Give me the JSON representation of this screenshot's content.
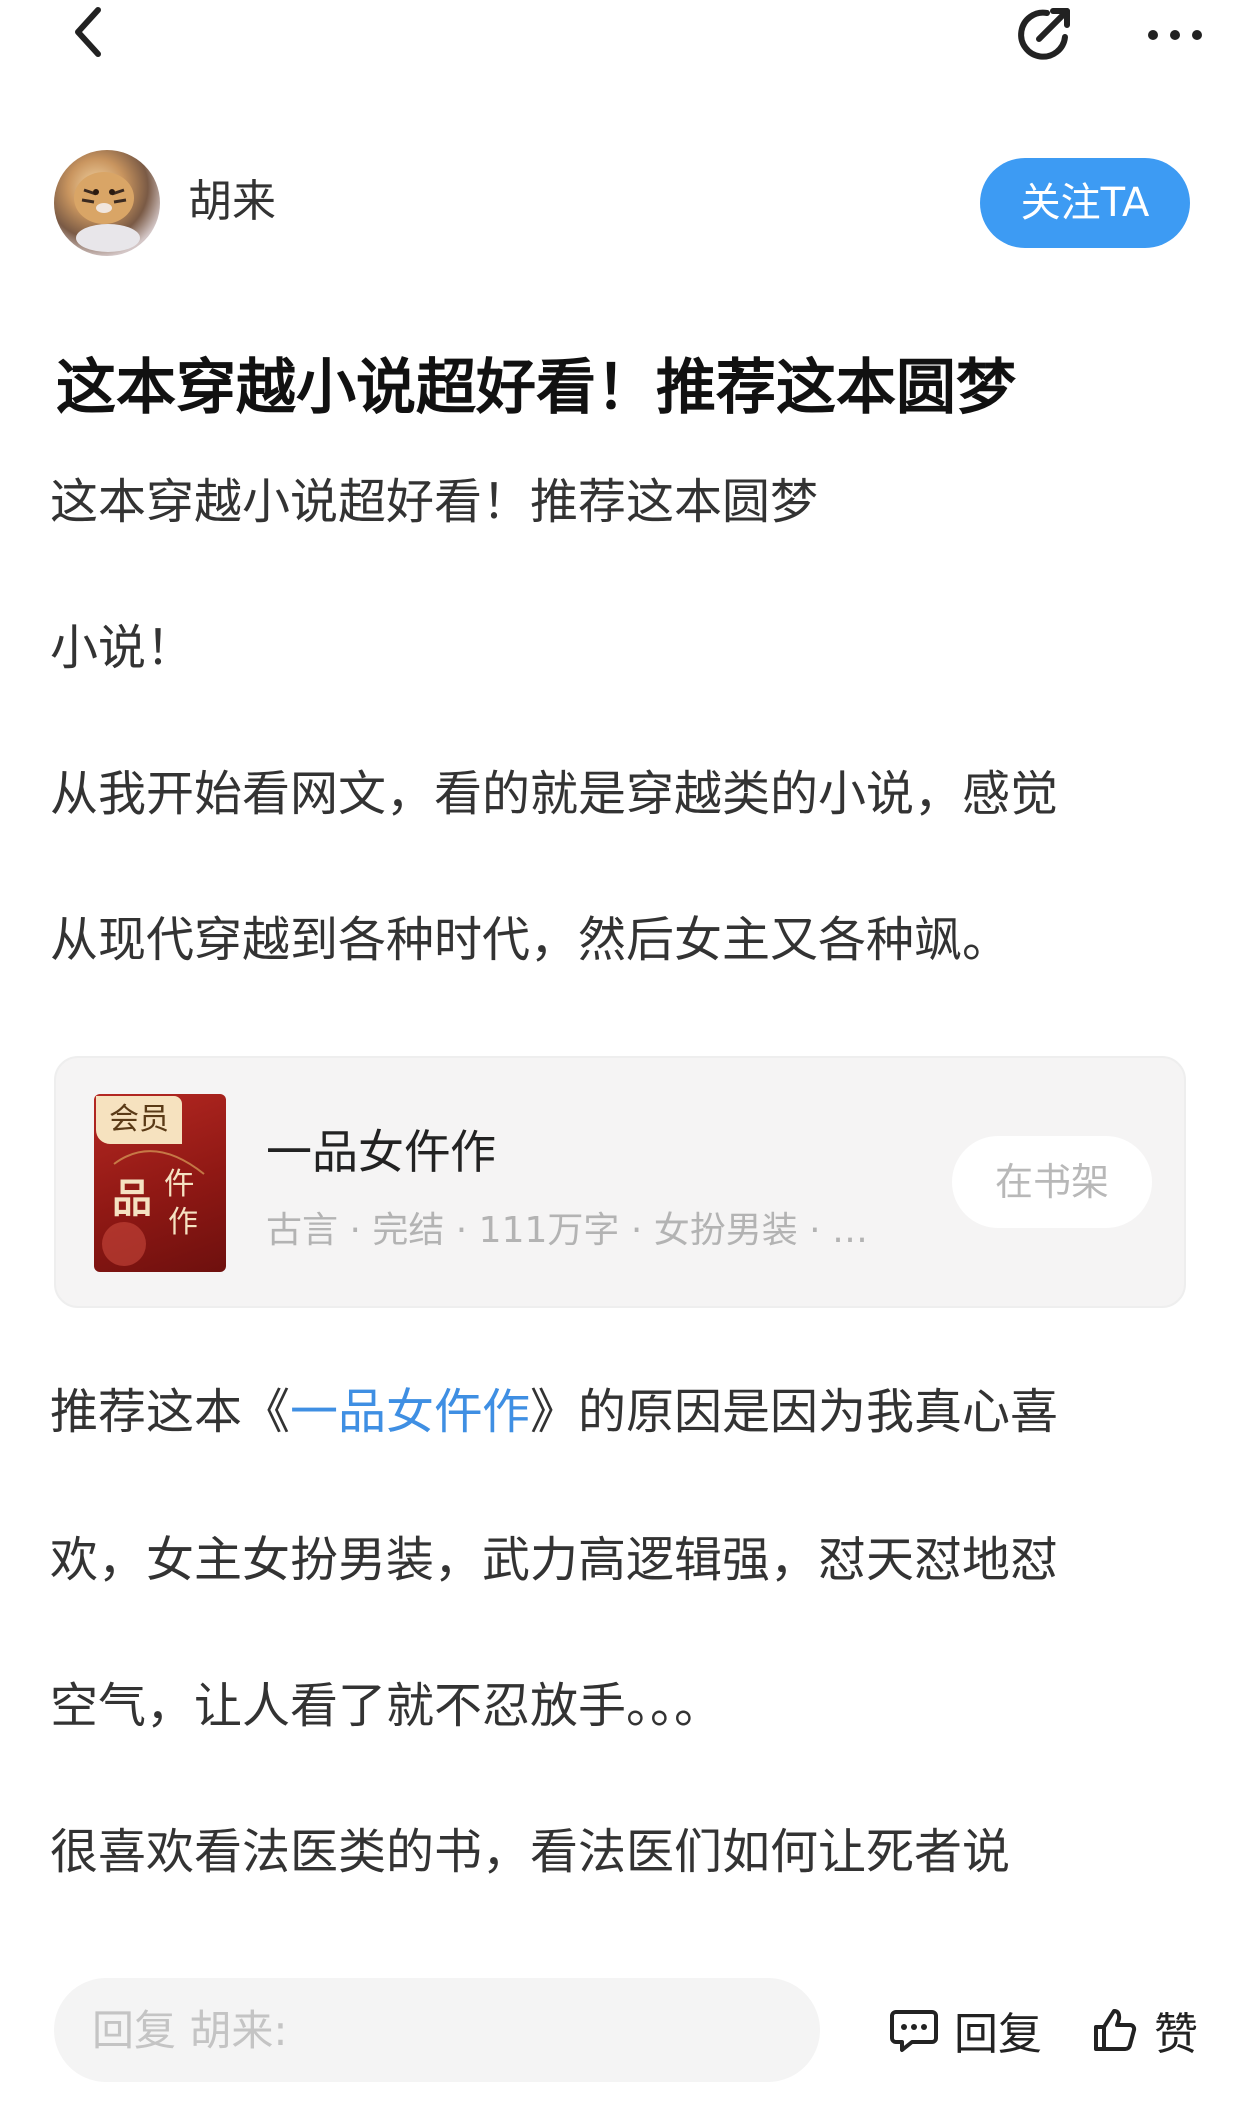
{
  "header": {
    "icons": [
      "chevron-left-icon",
      "share-icon",
      "more-icon"
    ]
  },
  "author": {
    "name": "胡来",
    "follow_label": "关注TA"
  },
  "post": {
    "title": "这本穿越小说超好看！推荐这本圆梦",
    "paragraphs": [
      "这本穿越小说超好看！推荐这本圆梦",
      "小说！",
      "从我开始看网文，看的就是穿越类的小说，感觉",
      "从现代穿越到各种时代，然后女主又各种飒。"
    ],
    "after_card": {
      "line1_prefix": "推荐这本《",
      "line1_link": "一品女仵作",
      "line1_suffix": "》的原因是因为我真心喜",
      "line2": "欢，女主女扮男装，武力高逻辑强，怼天怼地怼",
      "line3": "空气，让人看了就不忍放手。。。",
      "line4": "很喜欢看法医类的书，看法医们如何让死者说"
    }
  },
  "book_card": {
    "badge": "会员",
    "title": "一品女仵作",
    "meta": "古言 · 完结 · 111万字 · 女扮男装 · …",
    "shelf_label": "在书架",
    "cover_text": "一品女仵作"
  },
  "bottom_bar": {
    "reply_placeholder": "回复 胡来:",
    "reply_label": "回复",
    "like_label": "赞"
  },
  "colors": {
    "accent_blue": "#3d9bf3",
    "link_blue": "#3f8fe3",
    "cover_red": "#a01d18",
    "vip_gold": "#f6e2bf"
  }
}
